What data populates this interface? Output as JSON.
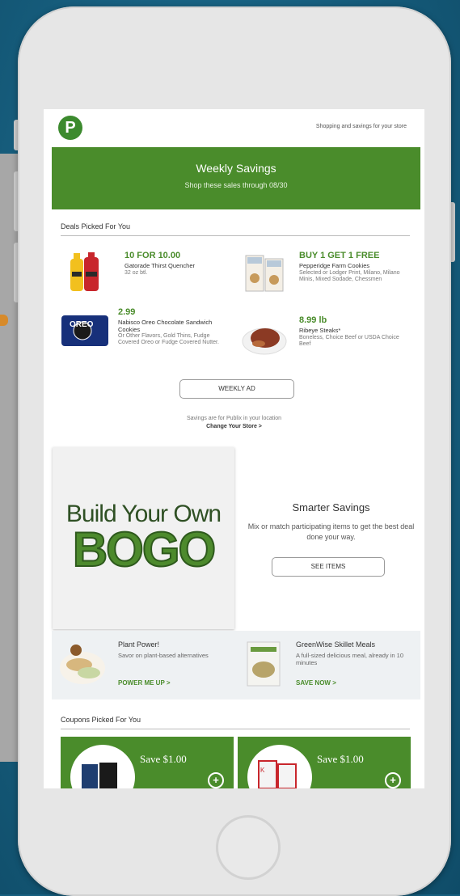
{
  "header": {
    "logo": "P",
    "store_text": "Shopping and savings for your store"
  },
  "banner": {
    "title": "Weekly Savings",
    "subtitle": "Shop these sales through 08/30"
  },
  "deals": {
    "section_title": "Deals Picked For You",
    "items": [
      {
        "price": "10 FOR 10.00",
        "name": "Gatorade Thirst Quencher",
        "desc": "32 oz btl."
      },
      {
        "price": "BUY 1 GET 1 FREE",
        "name": "Pepperidge Farm Cookies",
        "desc": "Selected or Lodger Print, Milano, Milano Minis, Mixed Sodade, Chessmen"
      },
      {
        "price": "2.99",
        "name": "Nabisco Oreo Chocolate Sandwich Cookies",
        "desc": "Or Other Flavors, Gold Thins, Fudge Covered Oreo or Fudge Covered Nutter."
      },
      {
        "price": "8.99 lb",
        "name": "Ribeye Steaks*",
        "desc": "Boneless, Choice Beef or USDA Choice Beef"
      }
    ],
    "weekly_ad_label": "WEEKLY AD",
    "store_note": "Savings are for Publix in your location",
    "change_store_label": "Change Your Store >"
  },
  "bogo": {
    "line1": "Build Your Own",
    "line2": "BOGO",
    "smart_title": "Smarter Savings",
    "smart_sub": "Mix or match participating items to get the best deal done your way.",
    "see_items_label": "SEE ITEMS"
  },
  "promos": [
    {
      "title": "Plant Power!",
      "desc": "Savor on plant-based alternatives",
      "link": "POWER ME UP >"
    },
    {
      "title": "GreenWise Skillet Meals",
      "desc": "A full-sized delicious meal, already in 10 minutes",
      "link": "SAVE NOW >"
    }
  ],
  "coupons": {
    "section_title": "Coupons Picked For You",
    "items": [
      {
        "save": "Save $1.00"
      },
      {
        "save": "Save $1.00"
      }
    ]
  },
  "colors": {
    "brand_green": "#4a8c2b",
    "background": "#175f7f"
  }
}
